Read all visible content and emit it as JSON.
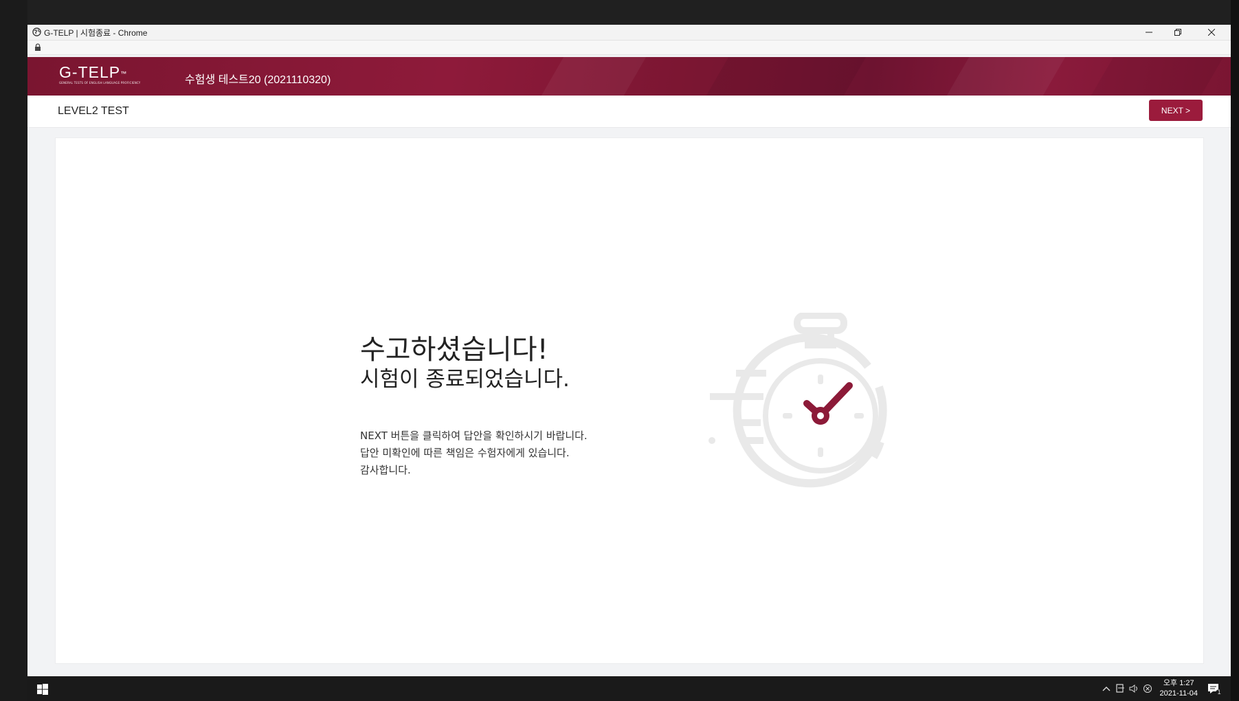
{
  "window": {
    "title": "G-TELP | 시험종료 - Chrome"
  },
  "header": {
    "logo_text": "G-TELP",
    "logo_tm": "™",
    "logo_tagline": "GENERAL TESTS OF ENGLISH LANGUAGE PROFICIENCY",
    "examinee": "수험생 테스트20 (2021110320)"
  },
  "subheader": {
    "level": "LEVEL2 TEST",
    "next_label": "NEXT >"
  },
  "main": {
    "heading": "수고하셨습니다!",
    "subheading": "시험이 종료되었습니다.",
    "lines": [
      "NEXT 버튼을 클릭하여 답안을 확인하시기 바랍니다.",
      "답안 미확인에 따른 책임은 수험자에게 있습니다.",
      "감사합니다."
    ]
  },
  "taskbar": {
    "time": "오후 1:27",
    "date": "2021-11-04",
    "notification_count": "1"
  },
  "colors": {
    "brand": "#9b1b3c",
    "stopwatch_gray": "#e8e8e8"
  }
}
